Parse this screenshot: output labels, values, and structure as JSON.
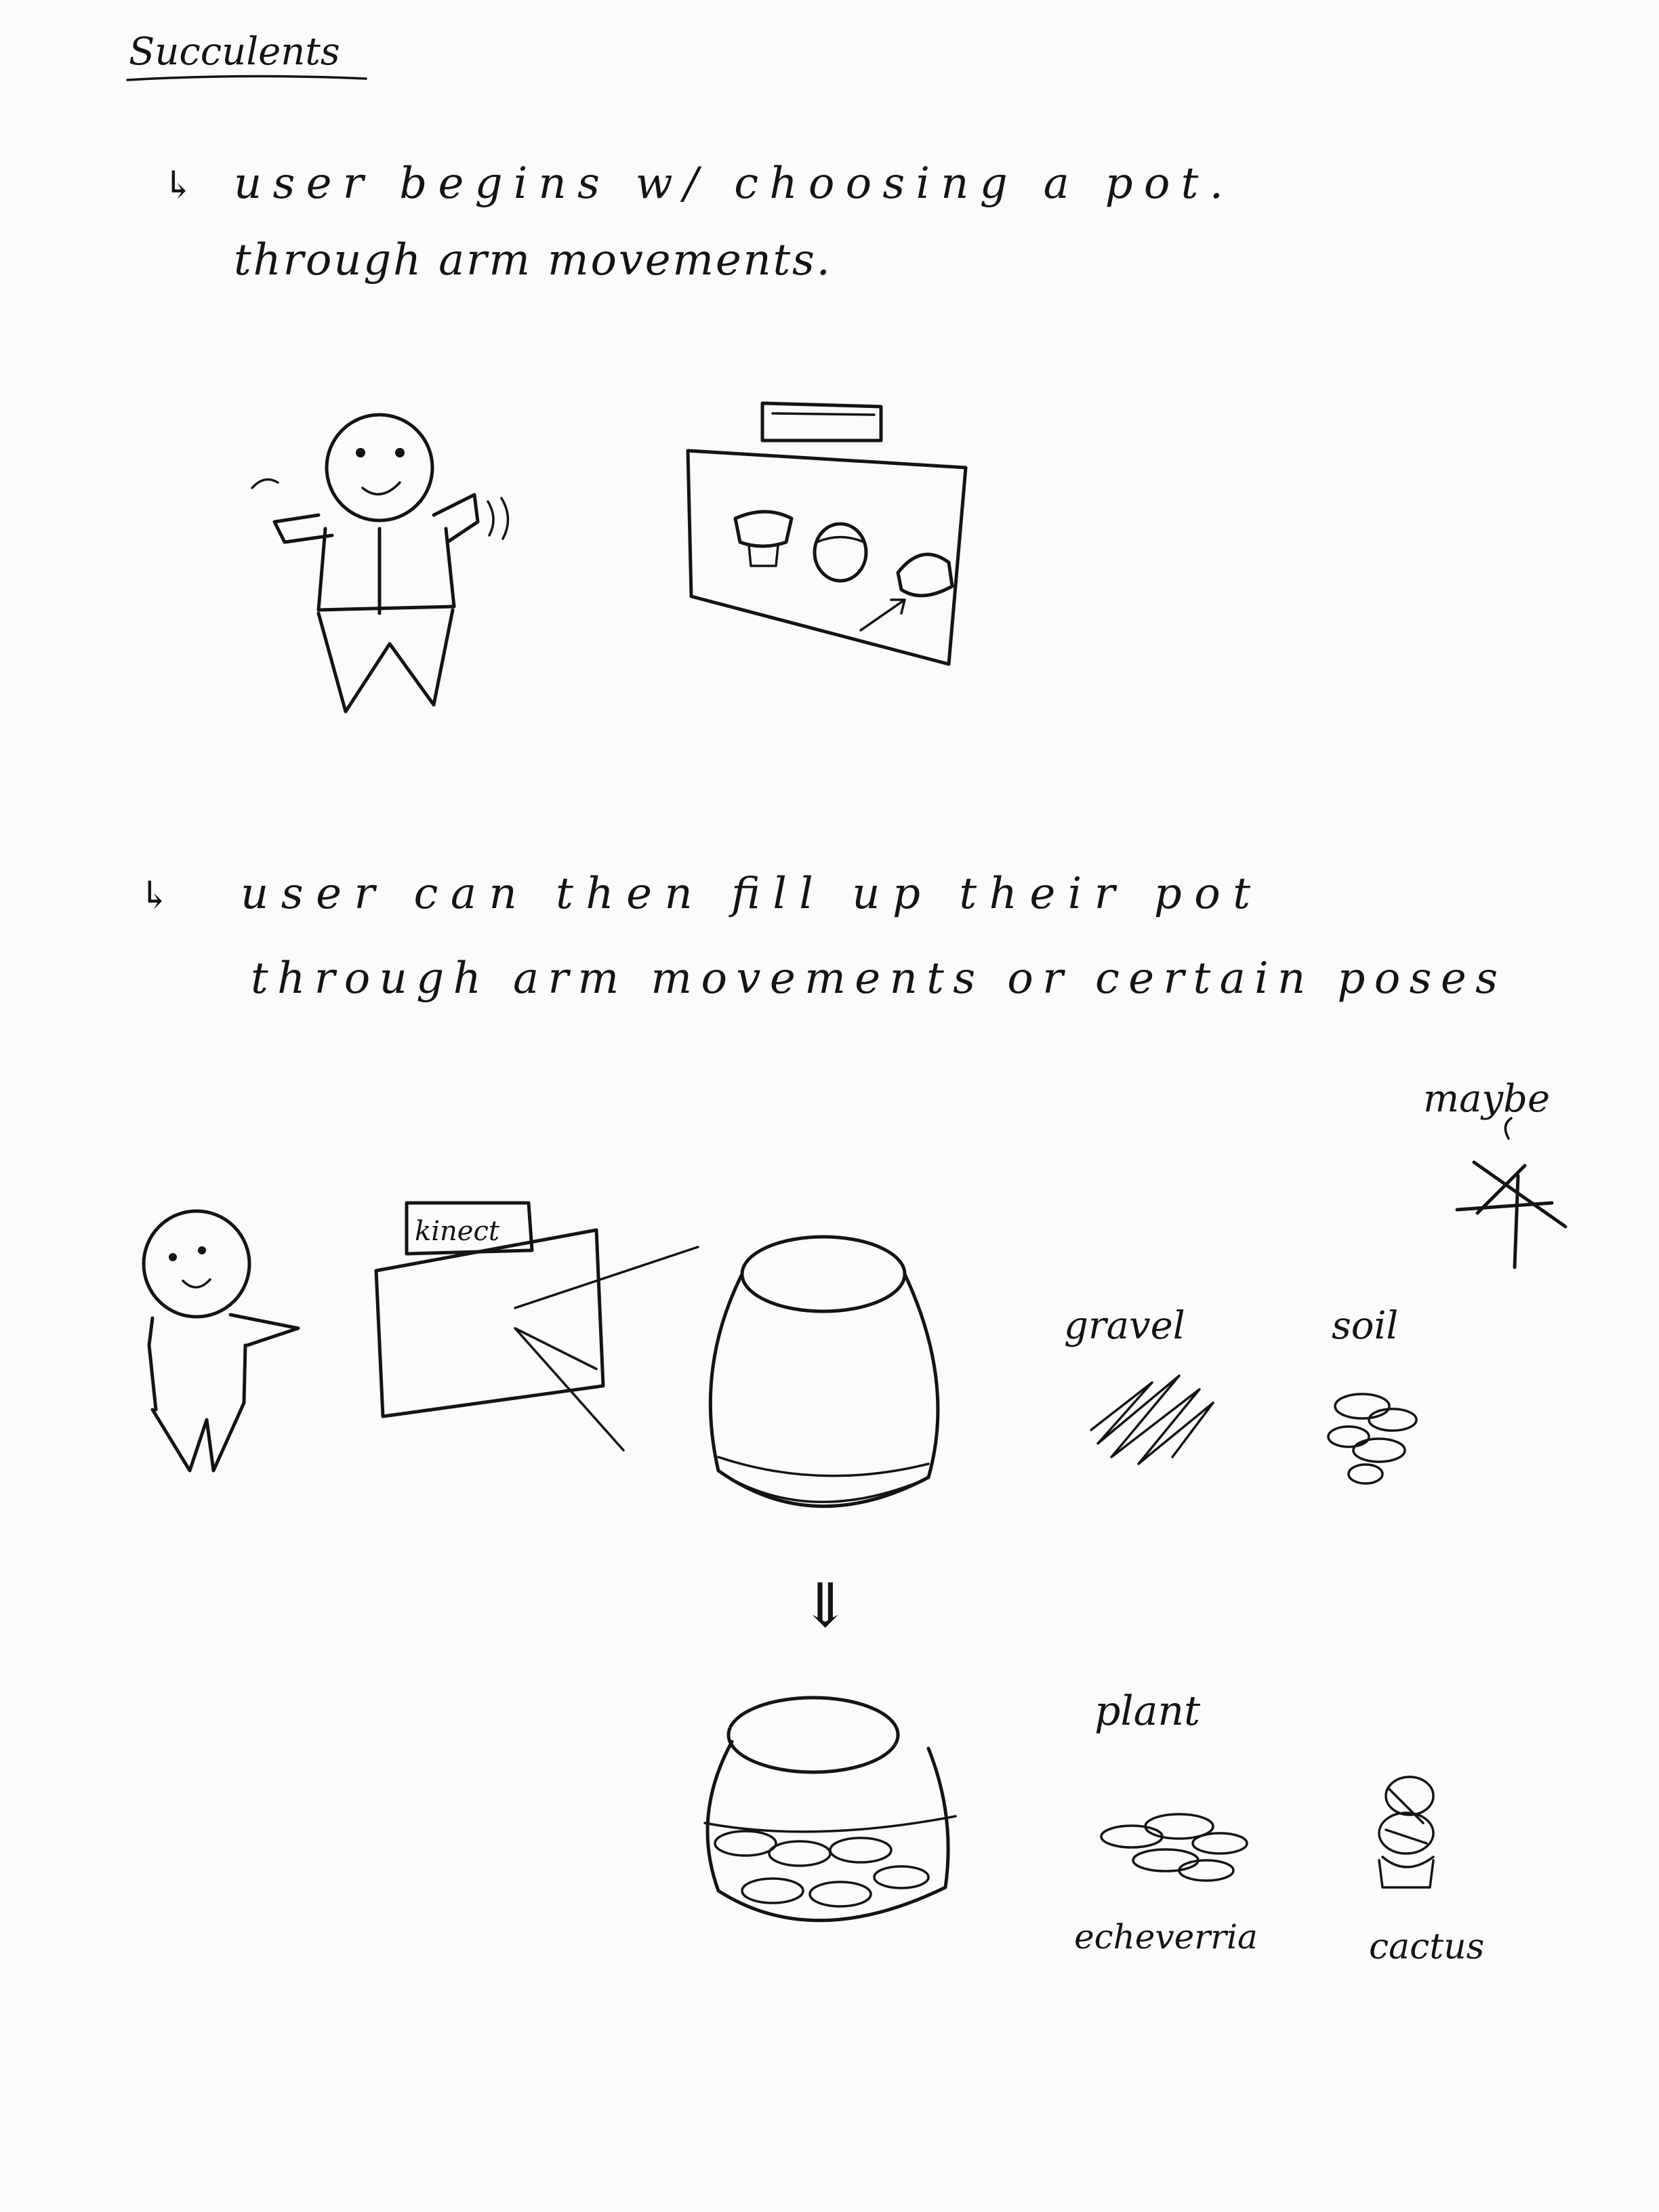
{
  "title": "Succulents",
  "notes": [
    {
      "arrow": "↳",
      "lines": [
        "user begins w/ choosing a pot.",
        "through arm movements."
      ]
    },
    {
      "arrow": "↳",
      "lines": [
        "user can then fill up their pot",
        "through arm movements or certain poses"
      ]
    }
  ],
  "sketch_labels": {
    "kinect": "kinect",
    "maybe": "maybe",
    "gravel": "gravel",
    "soil": "soil",
    "plant": "plant",
    "echeverria": "echeverria",
    "cactus": "cactus",
    "down_arrow": "⇓"
  },
  "colors": {
    "ink": "#141414",
    "paper": "#fbfbf9"
  }
}
